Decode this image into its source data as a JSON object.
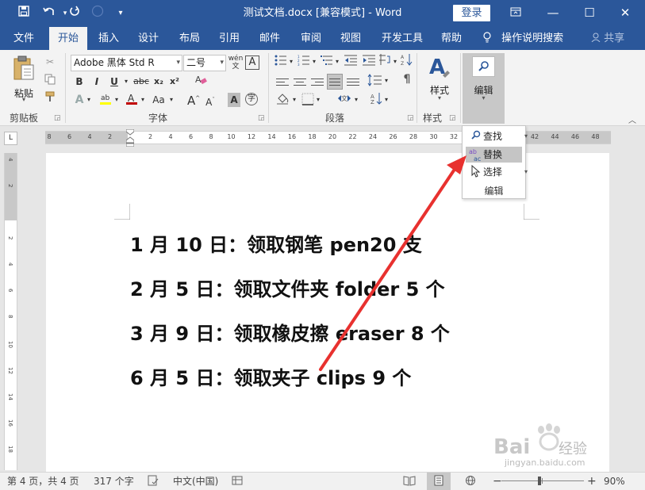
{
  "titlebar": {
    "doc_title": "测试文档.docx [兼容模式]  -  Word",
    "login": "登录",
    "icons": [
      "save-icon",
      "undo-icon",
      "redo-icon",
      "touch-mode-icon",
      "customize-icon"
    ],
    "window_buttons": [
      "ribbon-display-icon",
      "minimize-icon",
      "maximize-icon",
      "close-icon"
    ]
  },
  "menu": {
    "tabs": [
      "文件",
      "开始",
      "插入",
      "设计",
      "布局",
      "引用",
      "邮件",
      "审阅",
      "视图",
      "开发工具",
      "帮助"
    ],
    "active_tab": "开始",
    "tell_me": "操作说明搜索",
    "share": "共享"
  },
  "ribbon": {
    "clipboard": {
      "paste": "粘贴",
      "label": "剪贴板"
    },
    "font": {
      "font_name": "Adobe 黑体 Std R",
      "font_size": "二号",
      "label": "字体",
      "buttons": [
        "B",
        "I",
        "U",
        "abc",
        "x₂",
        "x²"
      ],
      "row3": [
        "A",
        "A",
        "Aa"
      ]
    },
    "paragraph": {
      "label": "段落"
    },
    "styles": {
      "button": "样式",
      "label": "样式"
    },
    "editing": {
      "button": "编辑"
    }
  },
  "dropdown": {
    "items": [
      {
        "label": "查找",
        "icon": "magnifier-icon"
      },
      {
        "label": "替换",
        "icon": "replace-icon"
      },
      {
        "label": "选择",
        "icon": "cursor-icon"
      }
    ],
    "group_label": "编辑"
  },
  "ruler": {
    "h_numbers": [
      "8",
      "6",
      "4",
      "2",
      "",
      "2",
      "4",
      "6",
      "8",
      "10",
      "12",
      "14",
      "16",
      "18",
      "20",
      "22",
      "24",
      "26",
      "28",
      "30",
      "32",
      "",
      "",
      "",
      "42",
      "44",
      "46",
      "48"
    ],
    "v_numbers": [
      "4",
      "2",
      "",
      "2",
      "4",
      "6",
      "8",
      "10",
      "12",
      "14",
      "16",
      "18"
    ],
    "corner": "L"
  },
  "document": {
    "lines": [
      "1 月 10 日：领取钢笔 pen20 支",
      "2 月 5 日：领取文件夹 folder 5 个",
      "3 月 9 日：领取橡皮擦 eraser 8 个",
      "6 月 5 日：领取夹子 clips 9 个"
    ]
  },
  "statusbar": {
    "page": "第 4 页，共 4 页",
    "words": "317 个字",
    "language": "中文(中国)",
    "zoom": "90%",
    "zoom_minus": "−",
    "zoom_plus": "+"
  },
  "watermark": {
    "brand": "Bai",
    "brand2": "du",
    "sub": "经验",
    "url": "jingyan.baidu.com"
  },
  "colors": {
    "accent": "#2b579a",
    "arrow": "#e8312f",
    "highlight": "#ffff00",
    "font_color": "#c00000"
  }
}
